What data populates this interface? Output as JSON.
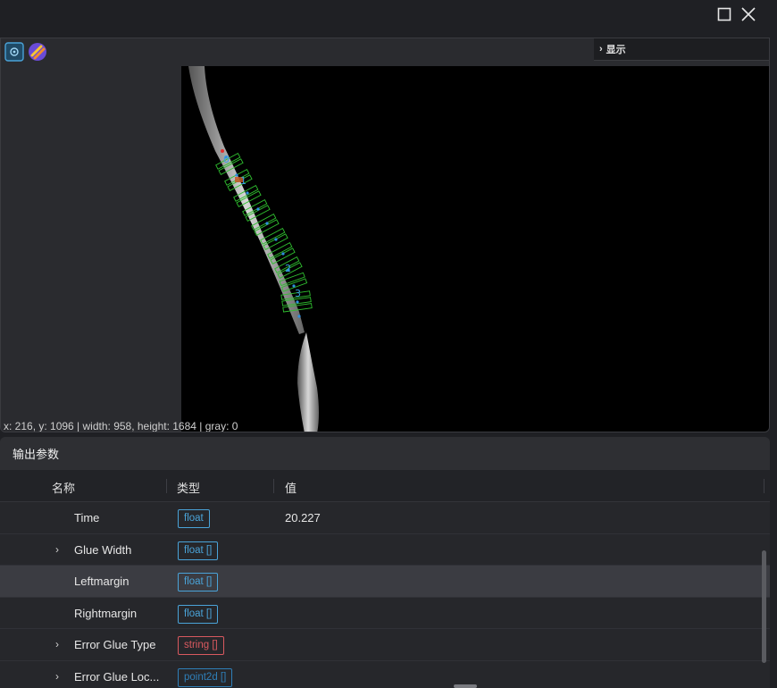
{
  "toolbar": {
    "display_label": "显示"
  },
  "viewer": {
    "status": "x: 216, y: 1096 | width: 958, height: 1684 | gray: 0",
    "overlay_labels": [
      "0",
      "1",
      "2",
      "3"
    ]
  },
  "output_panel": {
    "title": "输出参数",
    "columns": {
      "name": "名称",
      "type": "类型",
      "value": "值"
    },
    "rows": [
      {
        "name": "Time",
        "type": "float",
        "value": "20.227",
        "expandable": false,
        "color": "#4aa3d8"
      },
      {
        "name": "Glue Width",
        "type": "float []",
        "value": "",
        "expandable": true,
        "color": "#4aa3d8"
      },
      {
        "name": "Leftmargin",
        "type": "float []",
        "value": "",
        "expandable": false,
        "color": "#4aa3d8"
      },
      {
        "name": "Rightmargin",
        "type": "float []",
        "value": "",
        "expandable": false,
        "color": "#4aa3d8"
      },
      {
        "name": "Error Glue Type",
        "type": "string []",
        "value": "",
        "expandable": true,
        "color": "#d9595f"
      },
      {
        "name": "Error Glue Loc...",
        "type": "point2d []",
        "value": "",
        "expandable": true,
        "color": "#2f7fb8"
      }
    ]
  },
  "colors": {
    "accent_blue": "#4aa3d8",
    "accent_red": "#d9595f",
    "roi_green": "#2fbf2f"
  },
  "icons": {
    "maximize": "maximize-icon",
    "close": "close-icon",
    "fit_view": "fit-view-icon",
    "logo": "app-logo-icon"
  }
}
